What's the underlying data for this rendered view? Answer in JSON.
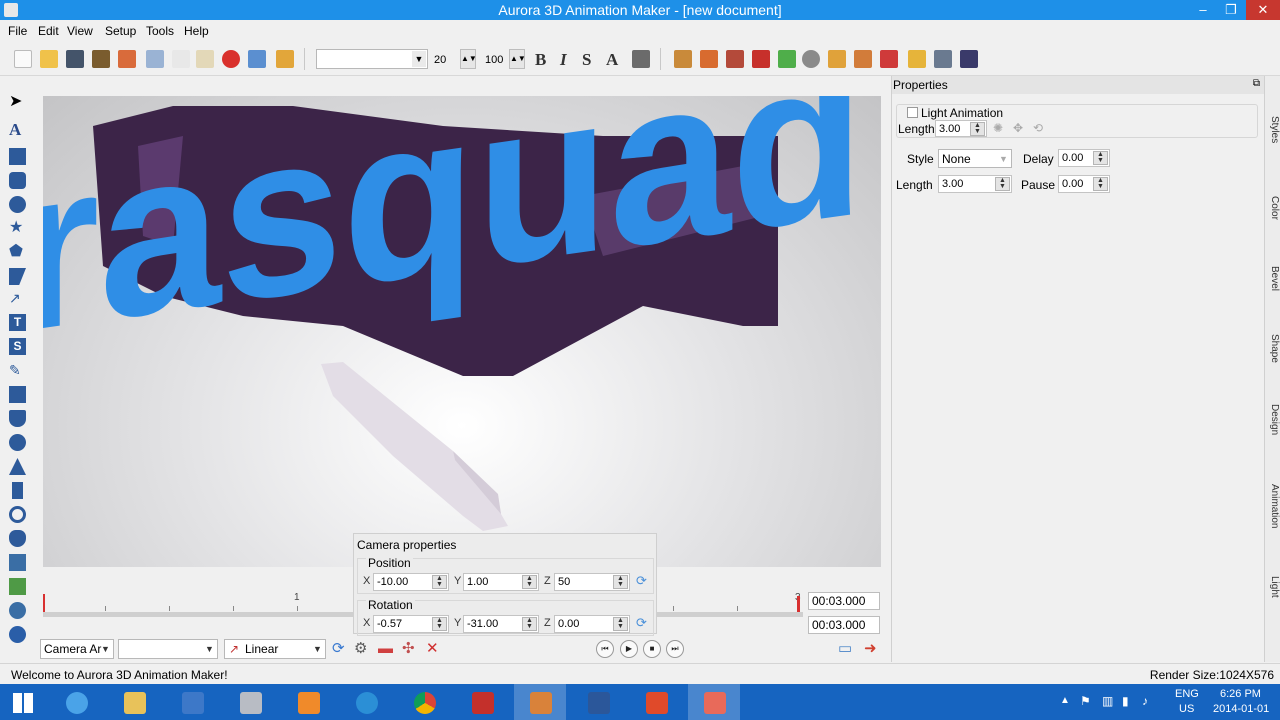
{
  "window": {
    "title": "Aurora 3D Animation Maker - [new document]",
    "minimize_glyph": "–",
    "restore_glyph": "❐",
    "close_glyph": "✕"
  },
  "menu": [
    "File",
    "Edit",
    "View",
    "Setup",
    "Tools",
    "Help"
  ],
  "toolbar": {
    "font_name": "",
    "font_size": "20",
    "font_scale": "100",
    "bold": "B",
    "italic": "I",
    "strike": "S",
    "outline": "A"
  },
  "viewport": {
    "scene_text": "rasquad",
    "colors": {
      "text_face": "#2f8ee6",
      "extrusion": "#3c2448"
    }
  },
  "timeline": {
    "tick_labels": [
      "1",
      "3"
    ],
    "current_time": "00:03.000",
    "total_time": "00:03.000"
  },
  "camera_panel": {
    "title": "Camera properties",
    "position": {
      "label": "Position",
      "x_label": "X",
      "x": "-10.00",
      "y_label": "Y",
      "y": "1.00",
      "z_label": "Z",
      "z": "50"
    },
    "rotation": {
      "label": "Rotation",
      "x_label": "X",
      "x": "-0.57",
      "y_label": "Y",
      "y": "-31.00",
      "z_label": "Z",
      "z": "0.00"
    }
  },
  "bottom_bar": {
    "object_select": "Camera Ar",
    "preset_select": "",
    "interpolation": "Linear"
  },
  "properties": {
    "title": "Properties",
    "light_animation": {
      "label": "Light Animation",
      "checked": false,
      "length_label": "Length",
      "length": "3.00"
    },
    "style_label": "Style",
    "style": "None",
    "delay_label": "Delay",
    "delay": "0.00",
    "length_label": "Length",
    "length": "3.00",
    "pause_label": "Pause",
    "pause": "0.00",
    "side_tabs": [
      "Styles",
      "Color",
      "Bevel",
      "Shape",
      "Design",
      "Animation",
      "Light"
    ]
  },
  "status": {
    "message": "Welcome to Aurora 3D Animation Maker!",
    "render_size": "Render Size:1024X576"
  },
  "taskbar": {
    "lang": "ENG",
    "region": "US",
    "time": "6:26 PM",
    "date": "2014-01-01"
  }
}
